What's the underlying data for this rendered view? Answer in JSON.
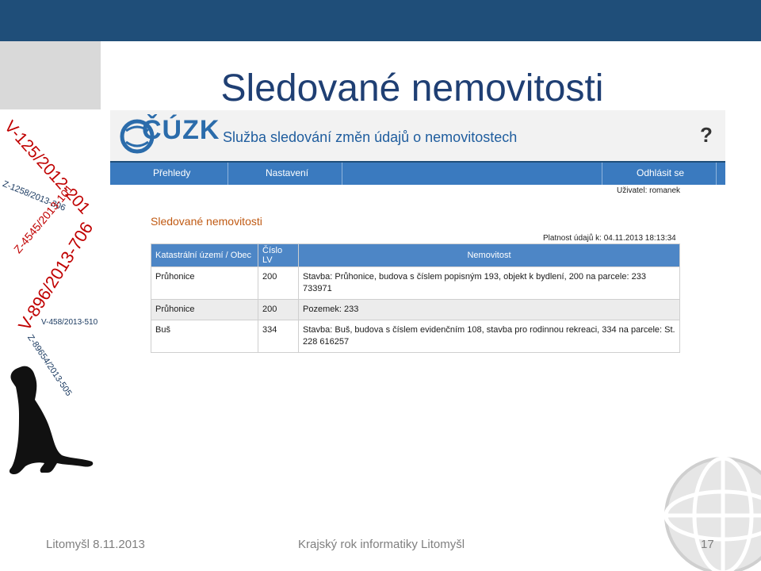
{
  "slide": {
    "title": "Sledované nemovitosti",
    "footer_left": "Litomyšl 8.11.2013",
    "footer_center": "Krajský rok informatiky Litomyšl",
    "page_number": "17"
  },
  "case_tags": [
    "V-125/2012-201",
    "Z-1258/2013-306",
    "Z-4545/2013-101",
    "V-896/2013-706",
    "V-458/2013-510",
    "Z-89654/2013-505"
  ],
  "app": {
    "logo_text": "ČÚZK",
    "service_title": "Služba sledování změn údajů o nemovitostech",
    "help_icon": "?",
    "nav": {
      "overview": "Přehledy",
      "settings": "Nastavení",
      "logout": "Odhlásit se"
    },
    "user_label": "Uživatel: romanek",
    "page_title": "Sledované nemovitosti",
    "validity": "Platnost údajů k: 04.11.2013 18:13:34",
    "columns": [
      "Katastrální území / Obec",
      "Číslo LV",
      "Nemovitost"
    ],
    "rows": [
      {
        "area": "Průhonice",
        "lv": "200",
        "property": "Stavba: Průhonice, budova s číslem popisným 193, objekt k bydlení, 200 na parcele: 233 733971"
      },
      {
        "area": "Průhonice",
        "lv": "200",
        "property": "Pozemek: 233"
      },
      {
        "area": "Buš",
        "lv": "334",
        "property": "Stavba: Buš, budova s číslem evidenčním 108, stavba pro rodinnou rekreaci, 334 na parcele: St. 228 616257"
      }
    ]
  },
  "colors": {
    "accent": "#1f4e79",
    "tag_red": "#c00000",
    "table_header": "#4d86c6"
  }
}
